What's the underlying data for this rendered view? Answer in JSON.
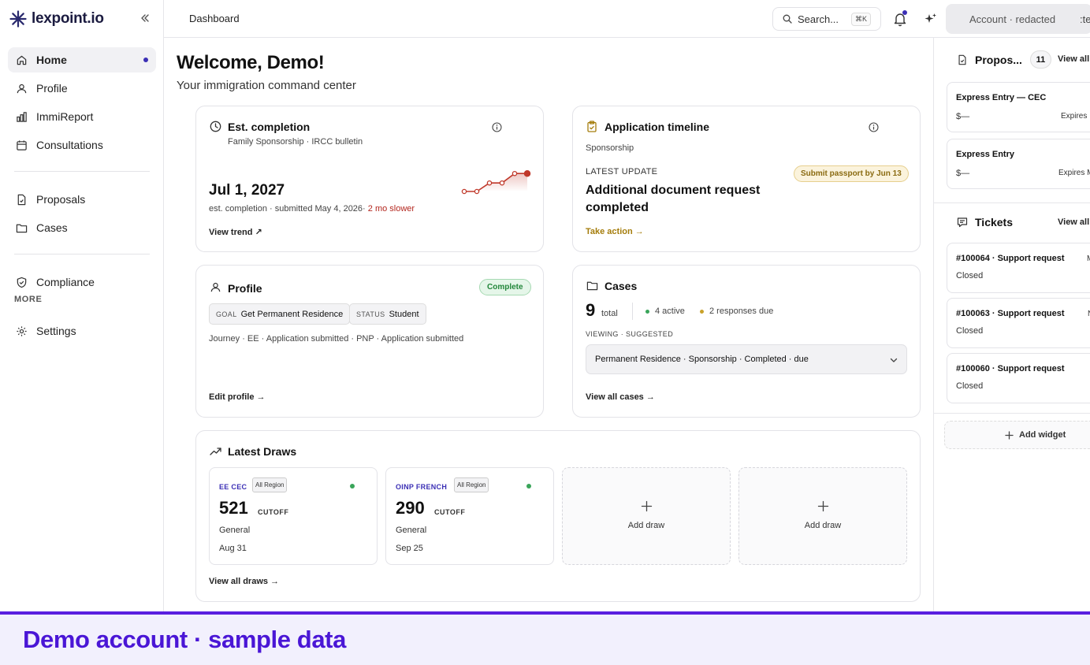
{
  "app": {
    "brand": "lexpoint.io"
  },
  "sidebar": {
    "items": [
      {
        "label": "Home",
        "icon": "home-icon"
      },
      {
        "label": "Profile",
        "icon": "user-icon"
      },
      {
        "label": "ImmiReport",
        "icon": "bar-chart-icon"
      },
      {
        "label": "Consultations",
        "icon": "calendar-icon"
      },
      {
        "label": "Proposals",
        "icon": "document-icon"
      },
      {
        "label": "Cases",
        "icon": "folder-icon"
      },
      {
        "label": "Compliance",
        "icon": "shield-icon"
      },
      {
        "label": "Settings",
        "icon": "gear-icon"
      }
    ],
    "more_label": "MORE"
  },
  "topbar": {
    "breadcrumb": "Dashboard",
    "search_placeholder": "Search...",
    "search_shortcut": "⌘K",
    "account_label": "Account · redacted",
    "account_tail": ":te"
  },
  "main": {
    "welcome": "Welcome, Demo!",
    "subtitle": "Your immigration command center"
  },
  "completion": {
    "title": "Est. completion",
    "subtitle": "Family Sponsorship · IRCC bulletin",
    "date": "Jul 1, 2027",
    "note": "est. completion · submitted May 4, 2026·",
    "delta": "2 mo slower",
    "link": "View trend ↗",
    "trend": [
      0,
      0,
      0.45,
      0.45,
      0.95,
      0.95
    ]
  },
  "timeline": {
    "title": "Application timeline",
    "subtitle": "Sponsorship",
    "update_label": "LATEST UPDATE",
    "update_line1": "Additional document request",
    "update_line2": "completed",
    "badge": "Submit passport by Jun 13",
    "link": "Take action →"
  },
  "profile": {
    "title": "Profile",
    "badge": "Complete",
    "goal_key": "GOAL",
    "goal_value": "Get Permanent Residence",
    "status_key": "STATUS",
    "status_value": "Student",
    "journey": "Journey · EE · Application submitted · PNP · Application submitted",
    "link": "Edit profile →"
  },
  "cases": {
    "title": "Cases",
    "total": "9",
    "total_label": "total",
    "active": "4 active",
    "due": "2 responses due",
    "viewing_label": "VIEWING · SUGGESTED",
    "selected": "Permanent Residence · Sponsorship · Completed · due",
    "link": "View all cases →"
  },
  "draws": {
    "title": "Latest Draws",
    "cards": [
      {
        "code": "EE CEC",
        "region": "All Region",
        "score": "521",
        "cutoff": "CUTOFF",
        "type": "General",
        "date": "Aug 31"
      },
      {
        "code": "OINP FRENCH",
        "region": "All Region",
        "score": "290",
        "cutoff": "CUTOFF",
        "type": "General",
        "date": "Sep 25"
      }
    ],
    "add_label": "Add draw",
    "link": "View all draws →"
  },
  "right": {
    "proposals_title": "Propos...",
    "proposals_count": "11",
    "view_all": "View all",
    "proposals": [
      {
        "title": "Express Entry — CEC",
        "amount": "$—",
        "right": "Expires"
      },
      {
        "title": "Express Entry",
        "amount": "$—",
        "right": "Expires M"
      }
    ],
    "tickets_title": "Tickets",
    "tickets": [
      {
        "title": "#100064 · Support request",
        "status": "Closed",
        "right": "M"
      },
      {
        "title": "#100063 · Support request",
        "status": "Closed",
        "right": "N"
      },
      {
        "title": "#100060 · Support request",
        "status": "Closed",
        "right": ""
      }
    ],
    "add_widget": "Add widget"
  },
  "banner": {
    "text": "Demo account · sample data"
  },
  "colors": {
    "accent": "#3b2fb5",
    "banner": "#4a16d6",
    "trend": "#c0392b",
    "warn": "#a57d0c",
    "ok": "#22863a"
  }
}
